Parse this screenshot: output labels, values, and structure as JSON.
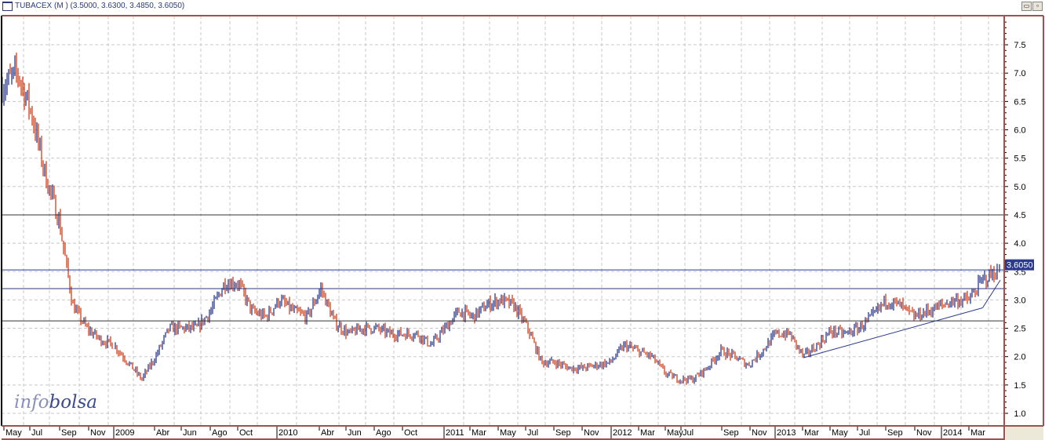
{
  "window": {
    "title": "TUBACEX (M ) (3.5000, 3.6300, 3.4850, 3.6050)",
    "buttons": [
      "restore",
      "close"
    ]
  },
  "logo": {
    "part1": "info",
    "part2": "bolsa"
  },
  "chart_data": {
    "type": "ohlc",
    "title": "TUBACEX (M ) (3.5000, 3.6300, 3.4850, 3.6050)",
    "last_ohlc": {
      "open": 3.5,
      "high": 3.63,
      "low": 3.485,
      "close": 3.605
    },
    "last_price_label": "3.6050",
    "ylim": [
      0.8,
      8.0
    ],
    "yticks": [
      "1.0",
      "1.5",
      "2.0",
      "2.5",
      "3.0",
      "3.5",
      "4.0",
      "4.5",
      "5.0",
      "5.5",
      "6.0",
      "6.5",
      "7.0",
      "7.5"
    ],
    "xticks": [
      "May",
      "Jul",
      "Sep",
      "Nov",
      "2009",
      "Abr",
      "Jun",
      "Ago",
      "Oct",
      "2010",
      "Abr",
      "Jun",
      "Ago",
      "Oct",
      "2011",
      "Mar",
      "May",
      "Jul",
      "Sep",
      "Nov",
      "2012",
      "Mar",
      "May",
      "Jul",
      "Sep",
      "Nov",
      "2013",
      "Mar",
      "May",
      "Jul",
      "Sep",
      "Nov",
      "2014",
      "Mar"
    ],
    "grid": true,
    "colors": {
      "up": "#2b3a8a",
      "down": "#d0401a",
      "hline": "#2b3a8a",
      "axis": "#a05050"
    },
    "approx_monthly_close": {
      "months": [
        "2008-04",
        "2008-05",
        "2008-06",
        "2008-07",
        "2008-08",
        "2008-09",
        "2008-10",
        "2008-11",
        "2008-12",
        "2009-01",
        "2009-02",
        "2009-03",
        "2009-04",
        "2009-05",
        "2009-06",
        "2009-07",
        "2009-08",
        "2009-09",
        "2009-10",
        "2009-11",
        "2009-12",
        "2010-01",
        "2010-02",
        "2010-03",
        "2010-04",
        "2010-05",
        "2010-06",
        "2010-07",
        "2010-08",
        "2010-09",
        "2010-10",
        "2010-11",
        "2010-12",
        "2011-01",
        "2011-02",
        "2011-03",
        "2011-04",
        "2011-05",
        "2011-06",
        "2011-07",
        "2011-08",
        "2011-09",
        "2011-10",
        "2011-11",
        "2011-12",
        "2012-01",
        "2012-02",
        "2012-03",
        "2012-04",
        "2012-05",
        "2012-06",
        "2012-07",
        "2012-08",
        "2012-09",
        "2012-10",
        "2012-11",
        "2012-12",
        "2013-01",
        "2013-02",
        "2013-03",
        "2013-04",
        "2013-05",
        "2013-06",
        "2013-07",
        "2013-08",
        "2013-09",
        "2013-10",
        "2013-11",
        "2013-12",
        "2014-01",
        "2014-02",
        "2014-03",
        "2014-04",
        "2014-05"
      ],
      "values": [
        6.5,
        6.8,
        7.0,
        6.3,
        5.2,
        4.4,
        2.9,
        2.5,
        2.3,
        2.2,
        1.9,
        1.6,
        2.0,
        2.5,
        2.5,
        2.5,
        2.8,
        3.3,
        3.3,
        2.8,
        2.7,
        3.0,
        2.8,
        2.7,
        3.2,
        2.6,
        2.4,
        2.5,
        2.5,
        2.4,
        2.4,
        2.4,
        2.2,
        2.5,
        2.8,
        2.7,
        2.9,
        3.0,
        2.9,
        2.5,
        1.9,
        1.9,
        1.8,
        1.8,
        1.85,
        1.9,
        2.2,
        2.1,
        2.0,
        1.7,
        1.6,
        1.6,
        1.8,
        2.1,
        2.0,
        1.85,
        2.1,
        2.4,
        2.4,
        2.0,
        2.2,
        2.45,
        2.4,
        2.5,
        2.7,
        3.0,
        2.9,
        2.7,
        2.8,
        2.9,
        3.0,
        3.0,
        3.35,
        3.5
      ]
    },
    "horizontal_lines": [
      {
        "value": 4.5,
        "color": "#333333"
      },
      {
        "value": 3.53,
        "color": "#2b3a8a"
      },
      {
        "value": 3.2,
        "color": "#2b3a8a"
      },
      {
        "value": 2.63,
        "color": "#333333"
      }
    ],
    "trendlines": [
      {
        "from": [
          "2013-03",
          1.98
        ],
        "to": [
          "2014-04",
          2.86
        ]
      },
      {
        "from": [
          "2014-04",
          2.86
        ],
        "to": [
          "2014-05",
          3.35
        ]
      }
    ]
  }
}
